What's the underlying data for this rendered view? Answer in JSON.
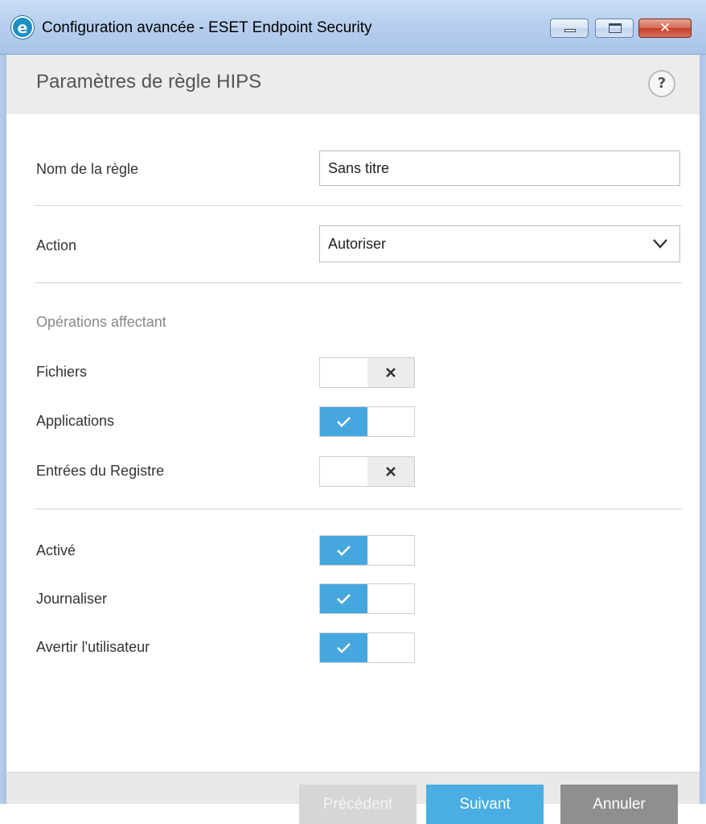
{
  "window": {
    "title": "Configuration avancée - ESET Endpoint Security",
    "app_icon_letter": "e",
    "close_glyph": "✕"
  },
  "header": {
    "title": "Paramètres de règle HIPS",
    "help_glyph": "?"
  },
  "form": {
    "rule_name": {
      "label": "Nom de la règle",
      "value": "Sans titre"
    },
    "action": {
      "label": "Action",
      "selected": "Autoriser"
    },
    "operations": {
      "section_label": "Opérations affectant",
      "files": {
        "label": "Fichiers",
        "enabled": false
      },
      "applications": {
        "label": "Applications",
        "enabled": true
      },
      "registry": {
        "label": "Entrées du Registre",
        "enabled": false
      }
    },
    "enabled": {
      "label": "Activé",
      "enabled": true
    },
    "log": {
      "label": "Journaliser",
      "enabled": true
    },
    "notify": {
      "label": "Avertir l'utilisateur",
      "enabled": true
    }
  },
  "footer": {
    "prev_label": "Précédent",
    "next_label": "Suivant",
    "cancel_label": "Annuler"
  },
  "colors": {
    "accent": "#45a7dd",
    "toggle_off": "#ececec",
    "cancel": "#8f8f8f"
  },
  "icons": {
    "check": "check-icon",
    "cross": "x-icon",
    "chevron": "chevron-down-icon",
    "help": "help-icon"
  }
}
